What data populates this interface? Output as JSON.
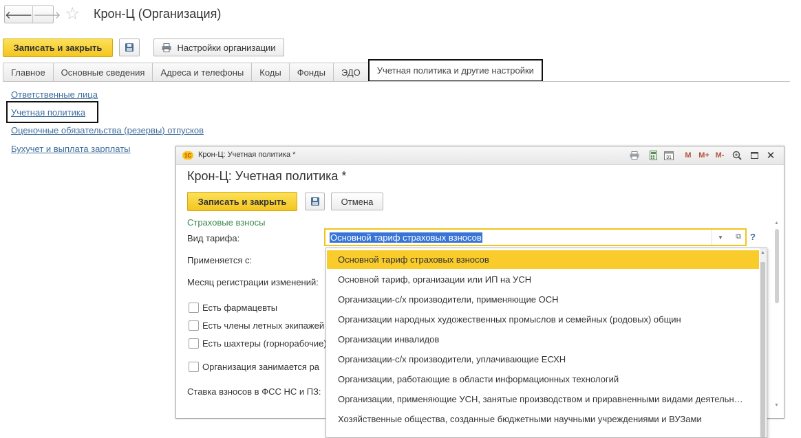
{
  "window": {
    "title": "Крон-Ц (Организация)",
    "nav": {
      "back": "🡐",
      "forward": "🡒",
      "star": "☆"
    }
  },
  "toolbar": {
    "save_close": "Записать и закрыть",
    "settings": "Настройки организации"
  },
  "tabs": [
    "Главное",
    "Основные сведения",
    "Адреса и телефоны",
    "Коды",
    "Фонды",
    "ЭДО",
    "Учетная политика и другие настройки"
  ],
  "links": [
    "Ответственные лица",
    "Учетная политика",
    "Оценочные обязательства (резервы) отпусков",
    "Бухучет и выплата зарплаты"
  ],
  "subwindow": {
    "logo": "1С",
    "title": "Крон-Ц: Учетная политика *",
    "heading": "Крон-Ц: Учетная политика *",
    "save_close": "Записать и закрыть",
    "cancel": "Отмена",
    "toolbar_icons": {
      "m": "M",
      "mplus": "M+",
      "mminus": "M-",
      "calendar_day": "31"
    },
    "section": "Страховые взносы",
    "fields": {
      "tariff_label": "Вид тарифа:",
      "tariff_value": "Основной тариф страховых взносов",
      "applies_from": "Применяется с:",
      "reg_month": "Месяц регистрации изменений:",
      "rate_fss": "Ставка взносов в ФСС НС и ПЗ:"
    },
    "checkboxes": [
      "Есть фармацевты",
      "Есть члены летных экипажей",
      "Есть шахтеры (горнорабочие)",
      "Организация занимается ра"
    ],
    "help": "?"
  },
  "dropdown": {
    "options": [
      "Основной тариф страховых взносов",
      "Основной тариф, организации или ИП на УСН",
      "Организации-с/х производители, применяющие ОСН",
      "Организации народных художественных промыслов и семейных (родовых) общин",
      "Организации инвалидов",
      "Организации-с/х производители, уплачивающие ЕСХН",
      "Организации, работающие в области информационных технологий",
      "Организации, применяющие УСН, занятые производством и приравненными видами деятельн…",
      "Хозяйственные общества, созданные бюджетными научными учреждениями и ВУЗами"
    ],
    "selected_index": 0
  },
  "colors": {
    "accent_yellow": "#f4c51f",
    "link_blue": "#3e6d9d",
    "section_green": "#3b8a4b",
    "selection_blue": "#3875d7"
  }
}
